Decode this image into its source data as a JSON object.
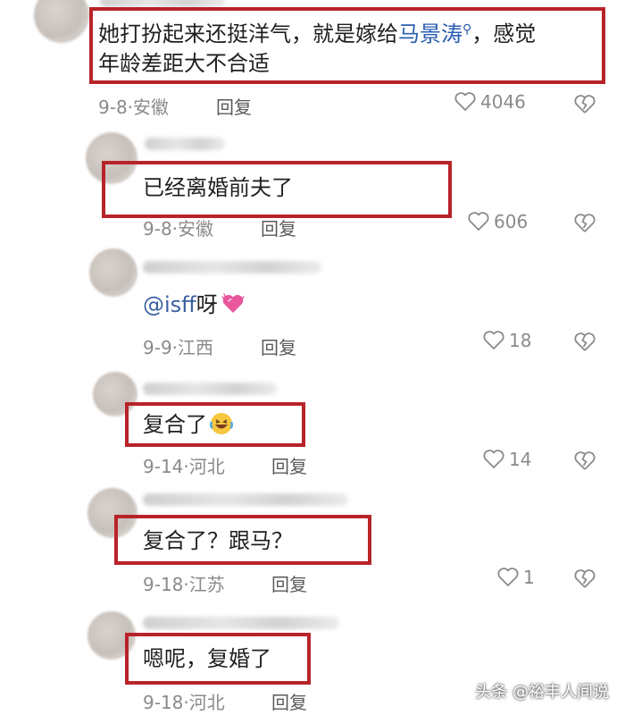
{
  "comments": [
    {
      "text_before": "她打扮起来还挺洋气，就是嫁给",
      "link": "马景涛",
      "text_after": "，感觉",
      "line2": "年龄差距大不合适",
      "date": "9-8",
      "location": "安徽",
      "reply": "回复",
      "likes": "4046"
    },
    {
      "text": "已经离婚前夫了",
      "date": "9-8",
      "location": "安徽",
      "reply": "回复",
      "likes": "606"
    },
    {
      "mention": "@isff",
      "text": "呀",
      "date": "9-9",
      "location": "江西",
      "reply": "回复",
      "likes": "18"
    },
    {
      "text": "复合了",
      "date": "9-14",
      "location": "河北",
      "reply": "回复",
      "likes": "14"
    },
    {
      "text": "复合了？跟马？",
      "date": "9-18",
      "location": "江苏",
      "reply": "回复",
      "likes": "1"
    },
    {
      "text": "嗯呢，复婚了",
      "date": "9-18",
      "location": "河北",
      "reply": "回复"
    }
  ],
  "separator": "·",
  "watermark": "头条 @裕丰人间说",
  "colors": {
    "highlight": "#b8232a",
    "link": "#2a5db0",
    "meta": "#8a8a8a"
  },
  "icons": {
    "like": "heart-outline-icon",
    "dislike": "broken-heart-icon",
    "search": "search-icon"
  }
}
